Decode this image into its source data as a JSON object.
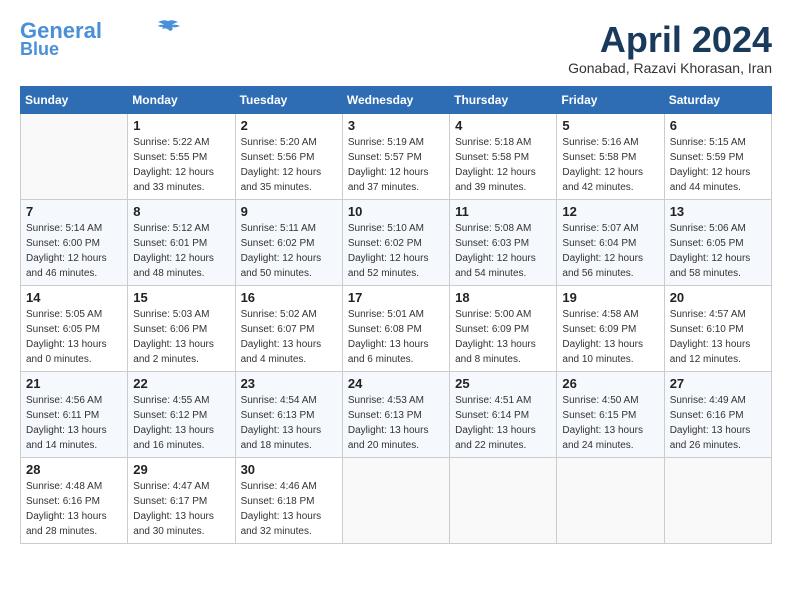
{
  "header": {
    "logo_line1": "General",
    "logo_line2": "Blue",
    "month": "April 2024",
    "location": "Gonabad, Razavi Khorasan, Iran"
  },
  "weekdays": [
    "Sunday",
    "Monday",
    "Tuesday",
    "Wednesday",
    "Thursday",
    "Friday",
    "Saturday"
  ],
  "weeks": [
    [
      {
        "day": "",
        "info": ""
      },
      {
        "day": "1",
        "info": "Sunrise: 5:22 AM\nSunset: 5:55 PM\nDaylight: 12 hours\nand 33 minutes."
      },
      {
        "day": "2",
        "info": "Sunrise: 5:20 AM\nSunset: 5:56 PM\nDaylight: 12 hours\nand 35 minutes."
      },
      {
        "day": "3",
        "info": "Sunrise: 5:19 AM\nSunset: 5:57 PM\nDaylight: 12 hours\nand 37 minutes."
      },
      {
        "day": "4",
        "info": "Sunrise: 5:18 AM\nSunset: 5:58 PM\nDaylight: 12 hours\nand 39 minutes."
      },
      {
        "day": "5",
        "info": "Sunrise: 5:16 AM\nSunset: 5:58 PM\nDaylight: 12 hours\nand 42 minutes."
      },
      {
        "day": "6",
        "info": "Sunrise: 5:15 AM\nSunset: 5:59 PM\nDaylight: 12 hours\nand 44 minutes."
      }
    ],
    [
      {
        "day": "7",
        "info": "Sunrise: 5:14 AM\nSunset: 6:00 PM\nDaylight: 12 hours\nand 46 minutes."
      },
      {
        "day": "8",
        "info": "Sunrise: 5:12 AM\nSunset: 6:01 PM\nDaylight: 12 hours\nand 48 minutes."
      },
      {
        "day": "9",
        "info": "Sunrise: 5:11 AM\nSunset: 6:02 PM\nDaylight: 12 hours\nand 50 minutes."
      },
      {
        "day": "10",
        "info": "Sunrise: 5:10 AM\nSunset: 6:02 PM\nDaylight: 12 hours\nand 52 minutes."
      },
      {
        "day": "11",
        "info": "Sunrise: 5:08 AM\nSunset: 6:03 PM\nDaylight: 12 hours\nand 54 minutes."
      },
      {
        "day": "12",
        "info": "Sunrise: 5:07 AM\nSunset: 6:04 PM\nDaylight: 12 hours\nand 56 minutes."
      },
      {
        "day": "13",
        "info": "Sunrise: 5:06 AM\nSunset: 6:05 PM\nDaylight: 12 hours\nand 58 minutes."
      }
    ],
    [
      {
        "day": "14",
        "info": "Sunrise: 5:05 AM\nSunset: 6:05 PM\nDaylight: 13 hours\nand 0 minutes."
      },
      {
        "day": "15",
        "info": "Sunrise: 5:03 AM\nSunset: 6:06 PM\nDaylight: 13 hours\nand 2 minutes."
      },
      {
        "day": "16",
        "info": "Sunrise: 5:02 AM\nSunset: 6:07 PM\nDaylight: 13 hours\nand 4 minutes."
      },
      {
        "day": "17",
        "info": "Sunrise: 5:01 AM\nSunset: 6:08 PM\nDaylight: 13 hours\nand 6 minutes."
      },
      {
        "day": "18",
        "info": "Sunrise: 5:00 AM\nSunset: 6:09 PM\nDaylight: 13 hours\nand 8 minutes."
      },
      {
        "day": "19",
        "info": "Sunrise: 4:58 AM\nSunset: 6:09 PM\nDaylight: 13 hours\nand 10 minutes."
      },
      {
        "day": "20",
        "info": "Sunrise: 4:57 AM\nSunset: 6:10 PM\nDaylight: 13 hours\nand 12 minutes."
      }
    ],
    [
      {
        "day": "21",
        "info": "Sunrise: 4:56 AM\nSunset: 6:11 PM\nDaylight: 13 hours\nand 14 minutes."
      },
      {
        "day": "22",
        "info": "Sunrise: 4:55 AM\nSunset: 6:12 PM\nDaylight: 13 hours\nand 16 minutes."
      },
      {
        "day": "23",
        "info": "Sunrise: 4:54 AM\nSunset: 6:13 PM\nDaylight: 13 hours\nand 18 minutes."
      },
      {
        "day": "24",
        "info": "Sunrise: 4:53 AM\nSunset: 6:13 PM\nDaylight: 13 hours\nand 20 minutes."
      },
      {
        "day": "25",
        "info": "Sunrise: 4:51 AM\nSunset: 6:14 PM\nDaylight: 13 hours\nand 22 minutes."
      },
      {
        "day": "26",
        "info": "Sunrise: 4:50 AM\nSunset: 6:15 PM\nDaylight: 13 hours\nand 24 minutes."
      },
      {
        "day": "27",
        "info": "Sunrise: 4:49 AM\nSunset: 6:16 PM\nDaylight: 13 hours\nand 26 minutes."
      }
    ],
    [
      {
        "day": "28",
        "info": "Sunrise: 4:48 AM\nSunset: 6:16 PM\nDaylight: 13 hours\nand 28 minutes."
      },
      {
        "day": "29",
        "info": "Sunrise: 4:47 AM\nSunset: 6:17 PM\nDaylight: 13 hours\nand 30 minutes."
      },
      {
        "day": "30",
        "info": "Sunrise: 4:46 AM\nSunset: 6:18 PM\nDaylight: 13 hours\nand 32 minutes."
      },
      {
        "day": "",
        "info": ""
      },
      {
        "day": "",
        "info": ""
      },
      {
        "day": "",
        "info": ""
      },
      {
        "day": "",
        "info": ""
      }
    ]
  ]
}
